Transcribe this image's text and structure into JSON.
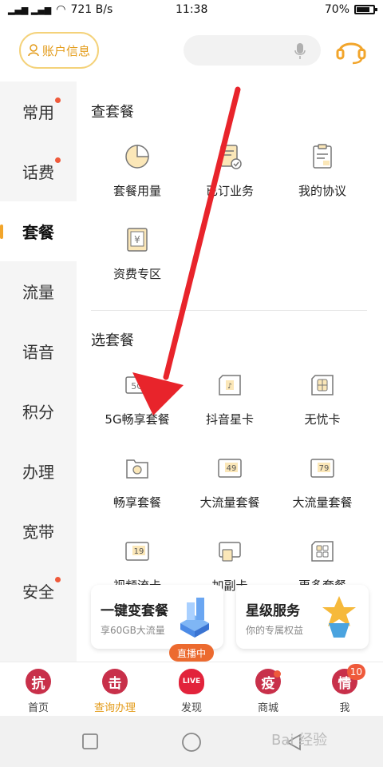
{
  "status_bar": {
    "net_left": "4G",
    "net_speed": "721 B/s",
    "time": "11:38",
    "battery": "70%"
  },
  "header": {
    "account_label": "账户信息",
    "search_placeholder": ""
  },
  "sidebar": {
    "items": [
      {
        "label": "常用"
      },
      {
        "label": "话费"
      },
      {
        "label": "套餐"
      },
      {
        "label": "流量"
      },
      {
        "label": "语音"
      },
      {
        "label": "积分"
      },
      {
        "label": "办理"
      },
      {
        "label": "宽带"
      },
      {
        "label": "安全"
      }
    ]
  },
  "sections": {
    "check": {
      "title": "查套餐",
      "items": [
        {
          "label": "套餐用量",
          "icon": "pie-chart-icon"
        },
        {
          "label": "已订业务",
          "icon": "subscribed-services-icon"
        },
        {
          "label": "我的协议",
          "icon": "agreement-clipboard-icon"
        },
        {
          "label": "资费专区",
          "icon": "fee-yen-icon"
        }
      ]
    },
    "choose": {
      "title": "选套餐",
      "items": [
        {
          "label": "5G畅享套餐",
          "icon": "5g-card-icon"
        },
        {
          "label": "抖音星卡",
          "icon": "douyin-card-icon"
        },
        {
          "label": "无忧卡",
          "icon": "sim-card-icon"
        },
        {
          "label": "畅享套餐",
          "icon": "enjoy-package-icon"
        },
        {
          "label": "大流量套餐",
          "icon": "49-plan-icon"
        },
        {
          "label": "大流量套餐",
          "icon": "79-plan-icon"
        },
        {
          "label": "视频流卡",
          "icon": "19-plan-icon"
        },
        {
          "label": "加副卡",
          "icon": "add-secondary-card-icon"
        },
        {
          "label": "更多套餐",
          "icon": "more-packages-icon"
        }
      ]
    }
  },
  "promos": [
    {
      "title": "一键变套餐",
      "subtitle": "享60GB大流量"
    },
    {
      "title": "星级服务",
      "subtitle": "你的专属权益"
    }
  ],
  "tabbar": {
    "live_badge": "直播中",
    "tabs": [
      {
        "label": "首页",
        "glyph": "抗"
      },
      {
        "label": "查询办理",
        "glyph": "击"
      },
      {
        "label": "发现",
        "glyph": "LIVE"
      },
      {
        "label": "商城",
        "glyph": "疫"
      },
      {
        "label": "我",
        "glyph": "情",
        "badge": "10"
      }
    ]
  },
  "watermark": "Bai 经验",
  "colors": {
    "accent": "#e39a17",
    "arrow": "#e8242b",
    "tab_circle": "#c8304a",
    "badge": "#ef5a3b"
  }
}
